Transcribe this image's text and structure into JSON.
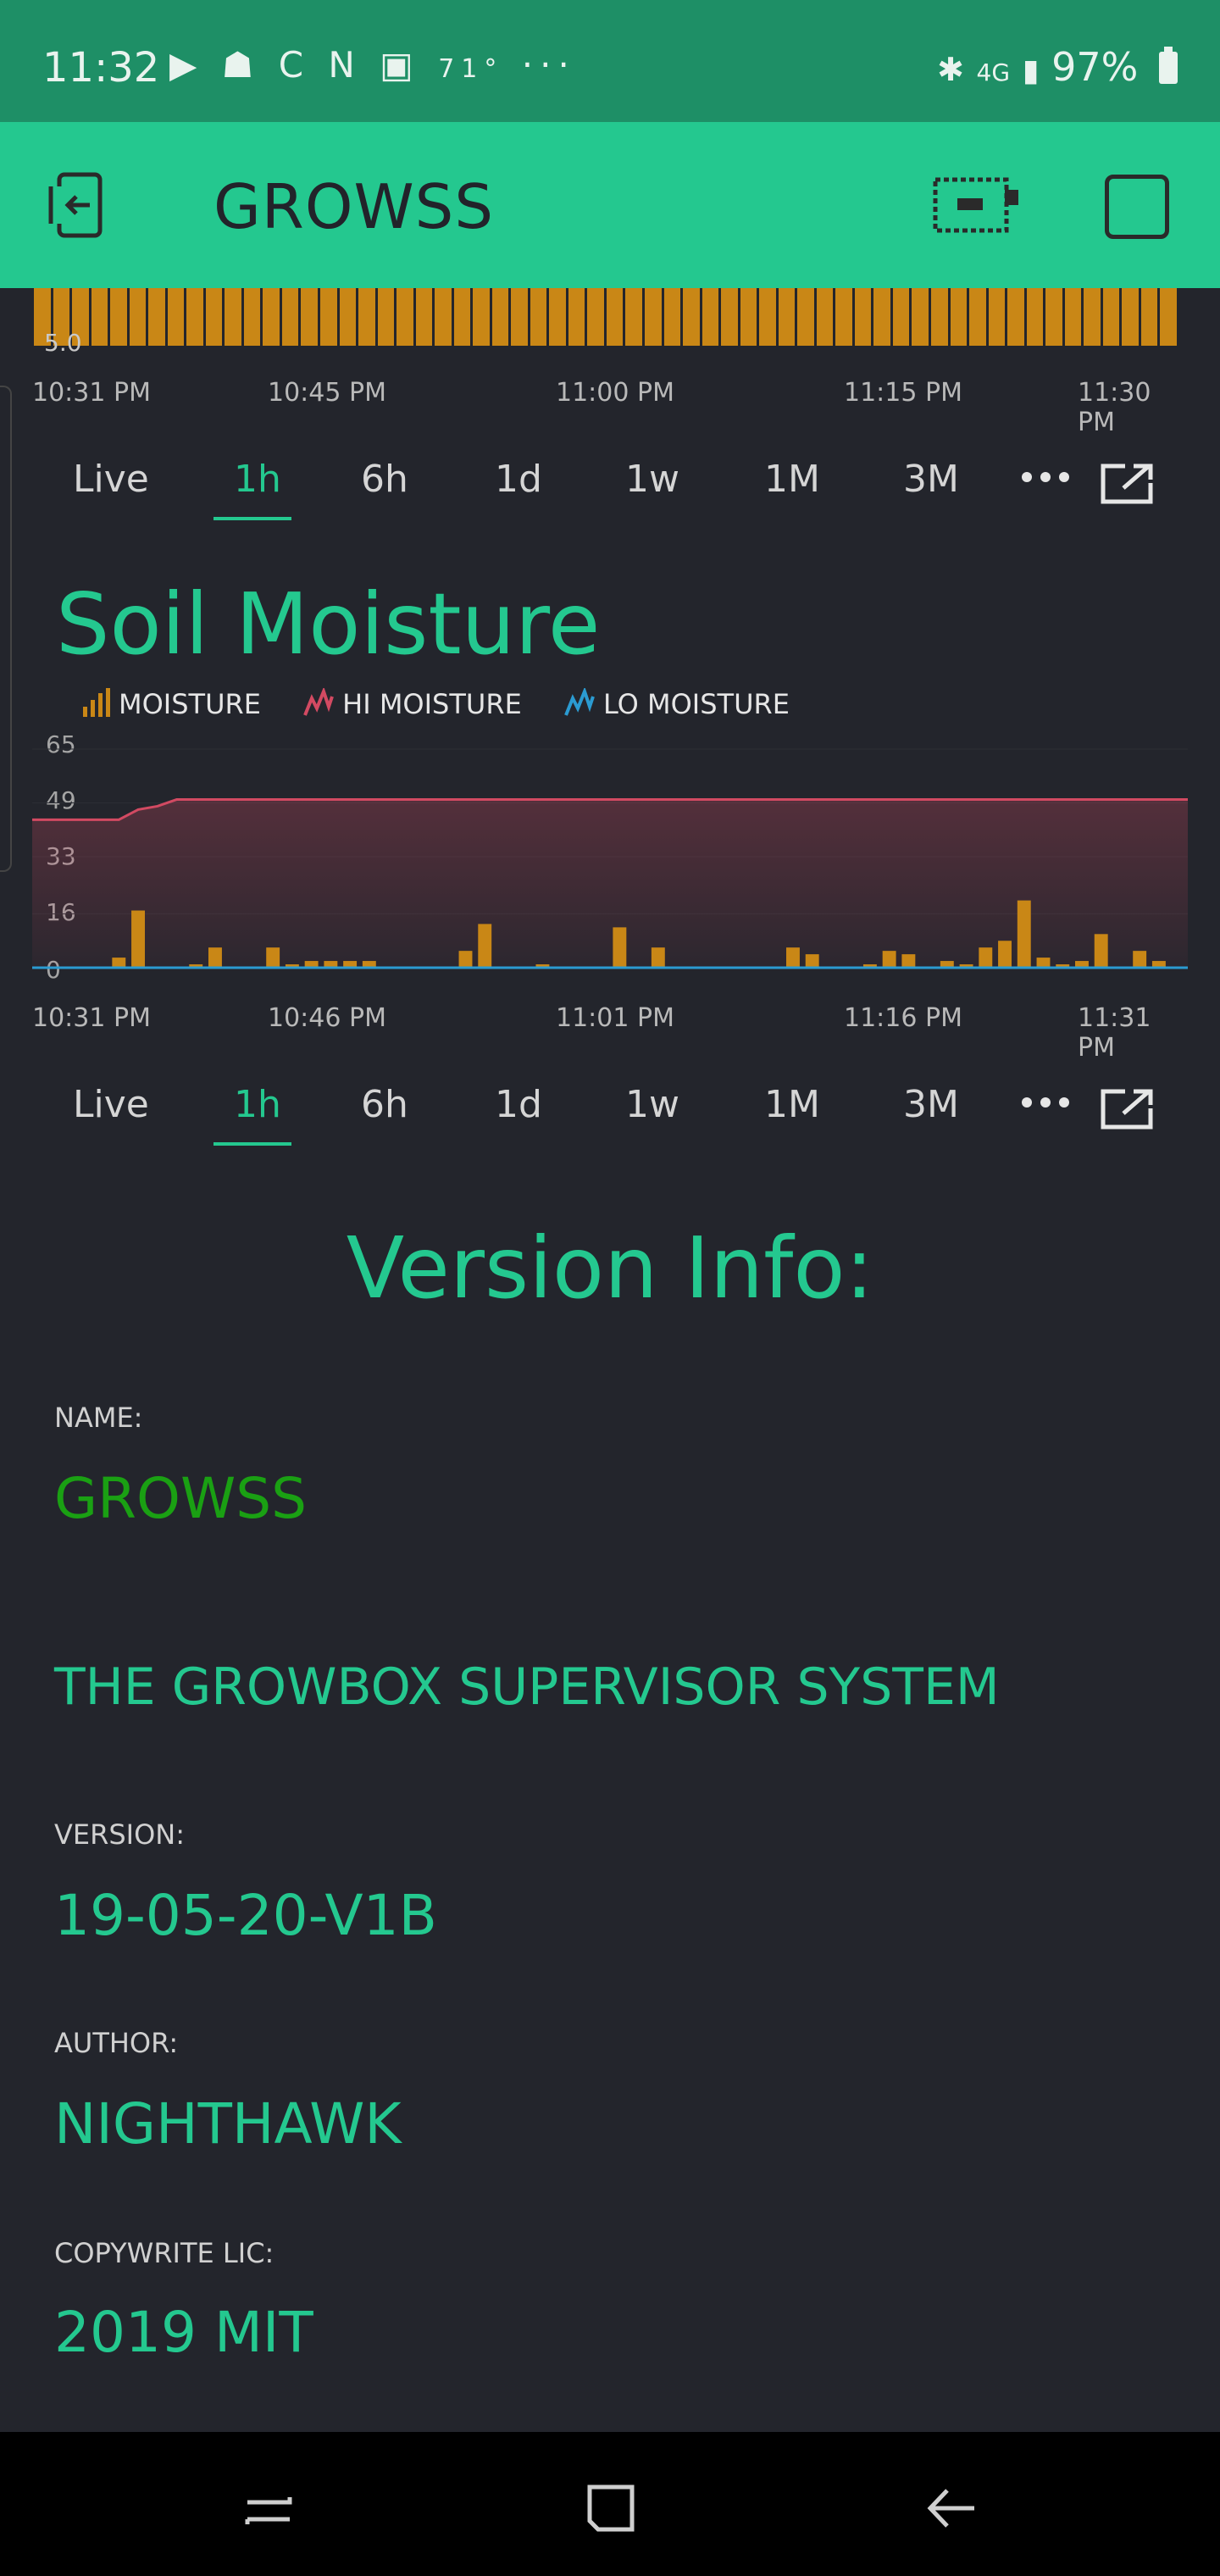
{
  "status_bar": {
    "time": "11:32",
    "icons": [
      "play-icon",
      "cat-icon",
      "c-icon",
      "n-icon",
      "gallery-icon"
    ],
    "temp": "71°",
    "more": "···",
    "network": "4G",
    "battery": "97%"
  },
  "app_bar": {
    "title": "GROWSS"
  },
  "top_chart": {
    "label": "5.0",
    "x_ticks": [
      "10:31 PM",
      "10:45 PM",
      "11:00 PM",
      "11:15 PM",
      "11:30 PM"
    ]
  },
  "ranges": [
    "Live",
    "1h",
    "6h",
    "1d",
    "1w",
    "1M",
    "3M"
  ],
  "active_range": "1h",
  "colors": {
    "accent": "#24c88f",
    "moisture": "#c98716",
    "hi_moisture": "#d24a62",
    "lo_moisture": "#2b9bd1",
    "name_value": "#1aa013"
  },
  "soil_chart": {
    "title": "Soil Moisture",
    "legend": [
      "MOISTURE",
      "HI MOISTURE",
      "LO MOISTURE"
    ],
    "y_ticks": [
      "65",
      "49",
      "33",
      "16",
      "0"
    ],
    "x_ticks": [
      "10:31 PM",
      "10:46 PM",
      "11:01 PM",
      "11:16 PM",
      "11:31 PM"
    ]
  },
  "chart_data": {
    "type": "bar",
    "title": "Soil Moisture",
    "ylim": [
      0,
      65
    ],
    "x_ticks": [
      "10:31 PM",
      "10:46 PM",
      "11:01 PM",
      "11:16 PM",
      "11:31 PM"
    ],
    "series": [
      {
        "name": "MOISTURE",
        "type": "bar",
        "values": [
          0,
          0,
          0,
          0,
          3,
          17,
          0,
          0,
          1,
          6,
          0,
          0,
          6,
          1,
          2,
          2,
          2,
          2,
          0,
          0,
          0,
          0,
          5,
          13,
          0,
          0,
          1,
          0,
          0,
          0,
          12,
          0,
          6,
          0,
          0,
          0,
          0,
          0,
          0,
          6,
          4,
          0,
          0,
          1,
          5,
          4,
          0,
          2,
          1,
          6,
          8,
          20,
          3,
          1,
          2,
          10,
          0,
          5,
          2,
          0
        ]
      },
      {
        "name": "HI MOISTURE",
        "type": "line",
        "values": [
          44,
          44,
          44,
          44,
          44,
          47,
          48,
          50,
          50,
          50,
          50,
          50,
          50,
          50,
          50,
          50,
          50,
          50,
          50,
          50,
          50,
          50,
          50,
          50,
          50,
          50,
          50,
          50,
          50,
          50,
          50,
          50,
          50,
          50,
          50,
          50,
          50,
          50,
          50,
          50,
          50,
          50,
          50,
          50,
          50,
          50,
          50,
          50,
          50,
          50,
          50,
          50,
          50,
          50,
          50,
          50,
          50,
          50,
          50,
          50
        ]
      },
      {
        "name": "LO MOISTURE",
        "type": "line",
        "values": [
          0,
          0,
          0,
          0,
          0,
          0,
          0,
          0,
          0,
          0,
          0,
          0,
          0,
          0,
          0,
          0,
          0,
          0,
          0,
          0,
          0,
          0,
          0,
          0,
          0,
          0,
          0,
          0,
          0,
          0,
          0,
          0,
          0,
          0,
          0,
          0,
          0,
          0,
          0,
          0,
          0,
          0,
          0,
          0,
          0,
          0,
          0,
          0,
          0,
          0,
          0,
          0,
          0,
          0,
          0,
          0,
          0,
          0,
          0,
          0
        ]
      }
    ]
  },
  "version_info": {
    "title": "Version Info:",
    "name_label": "NAME:",
    "name_value": "GROWSS",
    "description": "THE GROWBOX SUPERVISOR SYSTEM",
    "version_label": "VERSION:",
    "version_value": "19-05-20-V1B",
    "author_label": "AUTHOR:",
    "author_value": "NIGHTHAWK",
    "license_label": "COPYWRITE LIC:",
    "license_value": "2019 MIT"
  }
}
